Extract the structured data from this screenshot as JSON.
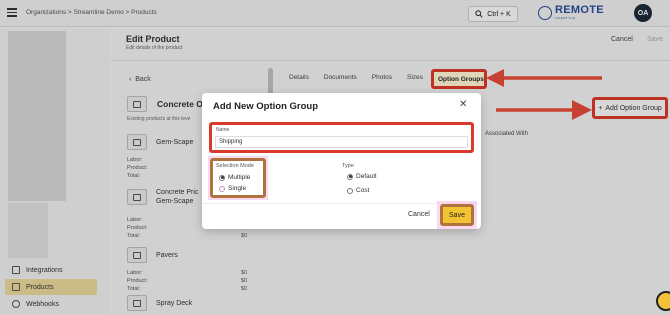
{
  "topbar": {
    "breadcrumb": "Organizations > Streamline Demo > Products",
    "search_label": "Ctrl + K",
    "logo_text": "REMOTE",
    "logo_sub": "LIFESTYLE",
    "avatar_initials": "OA"
  },
  "sidebar": {
    "items": [
      {
        "label": "Integrations",
        "icon": "grid-icon",
        "active": false
      },
      {
        "label": "Products",
        "icon": "box-icon",
        "active": true
      },
      {
        "label": "Webhooks",
        "icon": "webhook-icon",
        "active": false
      }
    ]
  },
  "page": {
    "title": "Edit Product",
    "subtitle": "Edit details of the product",
    "cancel_label": "Cancel",
    "save_label": "Save"
  },
  "left_panel": {
    "back_label": "Back",
    "product_title": "Concrete Of",
    "existing_text": "Existing products at this leve",
    "products": [
      {
        "name": "Gem-Scape"
      },
      {
        "name": "Concrete Pric\nGem-Scape"
      },
      {
        "name": "Pavers"
      },
      {
        "name": "Spray Deck"
      }
    ],
    "cost_labels": [
      "Labor:",
      "Product:",
      "Total:"
    ],
    "cost_value": "$0"
  },
  "tabs": [
    "Details",
    "Documents",
    "Photos",
    "Sizes",
    "Option Groups"
  ],
  "add_option_group_label": "Add Option Group",
  "associated_with_label": "Associated With",
  "modal": {
    "title": "Add New Option Group",
    "name_label": "Name",
    "name_value": "Shipping",
    "selection_mode_label": "Selection Mode",
    "selection_modes": [
      {
        "label": "Multiple",
        "checked": true
      },
      {
        "label": "Single",
        "checked": false
      }
    ],
    "type_label": "Type",
    "types": [
      {
        "label": "Default",
        "checked": true
      },
      {
        "label": "Cost",
        "checked": false
      }
    ],
    "cancel_label": "Cancel",
    "save_label": "Save"
  },
  "colors": {
    "highlight_red": "#d93a2b",
    "highlight_brown": "#b0733d",
    "save_yellow": "#f1c232",
    "active_nav": "#e8d79a"
  }
}
